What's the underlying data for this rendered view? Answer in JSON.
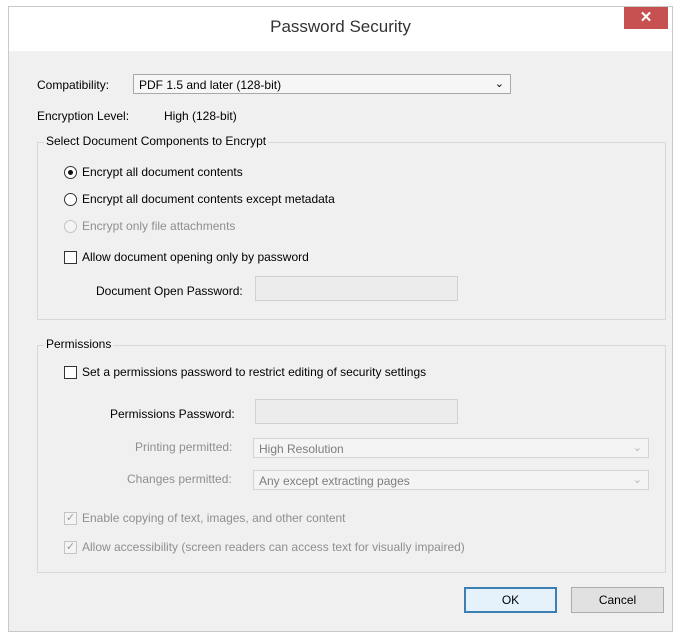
{
  "window": {
    "title": "Password Security",
    "close_glyph": "✕"
  },
  "compatibility": {
    "label": "Compatibility:",
    "value": "PDF 1.5 and later (128-bit)"
  },
  "encryption": {
    "label": "Encryption  Level:",
    "value": "High (128-bit)"
  },
  "components": {
    "legend": "Select Document Components to Encrypt",
    "option_all": "Encrypt all document contents",
    "option_except_metadata": "Encrypt all document contents except metadata",
    "option_attachments": "Encrypt only file attachments",
    "selected": "option_all",
    "require_open_password_label": "Allow document opening only by password",
    "require_open_password_checked": false,
    "open_password_label": "Document Open Password:",
    "open_password_value": ""
  },
  "permissions": {
    "legend": "Permissions",
    "restrict_label": "Set a permissions password to restrict editing of security settings",
    "restrict_checked": false,
    "password_label": "Permissions Password:",
    "password_value": "",
    "printing_label": "Printing permitted:",
    "printing_value": "High Resolution",
    "changes_label": "Changes permitted:",
    "changes_value": "Any except extracting pages",
    "copy_label": "Enable copying of text, images, and other content",
    "copy_checked": true,
    "accessibility_label": "Allow accessibility (screen readers can access text for visually impaired)",
    "accessibility_checked": true
  },
  "buttons": {
    "ok": "OK",
    "cancel": "Cancel"
  },
  "icons": {
    "chevron": "⌄",
    "check": "✓"
  }
}
